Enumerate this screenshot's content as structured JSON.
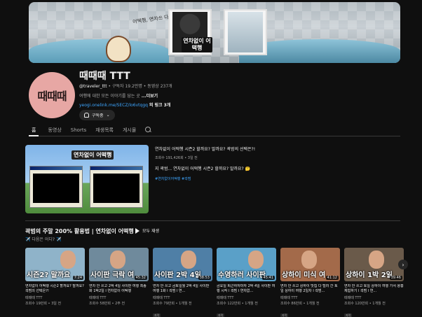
{
  "banner": {
    "title": "연차없이 어떡행",
    "mascot_text": "어떡행, 연차쓰 다 때때하네"
  },
  "channel": {
    "avatar_text": "때때때",
    "name": "때때때 TTT",
    "handle": "@traveler_ttt",
    "subscribers": "구독자 19.2만명",
    "videos": "동영상 237개",
    "description": "여행에 대한 모든 이야기를 담는 곳",
    "more_label": "...더보기",
    "link": "yeogi.onelink.me/SECZ/lo6vtqgq",
    "link_extra": "외 링크 3개",
    "subscribe_label": "구독중",
    "subscribe_chevron": "⌄"
  },
  "tabs": [
    {
      "label": "홈",
      "active": true
    },
    {
      "label": "동영상",
      "active": false
    },
    {
      "label": "Shorts",
      "active": false
    },
    {
      "label": "재생목록",
      "active": false
    },
    {
      "label": "게시물",
      "active": false
    }
  ],
  "featured": {
    "thumb_logo": "연차없이 어떡행",
    "title": "연차없이 어떡행 시즌2 할까요? 말까요? 곽범의 선택은?!",
    "meta": "조회수 191,426회 • 3일 전",
    "description": "지 곽범... 연차없이 어떡행 시즌2 할까요? 말까요? 🤔",
    "tags": "#연차없이어떡행 #곽범"
  },
  "section": {
    "title": "곽범의 주말 200% 활용법 | 연차없이 어떡행",
    "play_all": "모두 재생",
    "subtitle": "✈️ 다음은 어디? ✈️"
  },
  "cards": [
    {
      "caption": "시즌2? 말까요",
      "duration": "7:24",
      "title": "연차없이 어떡행 시즌2 할까요? 말까요? 곽범의 선택은?!",
      "channel": "때때때 TTT",
      "meta": "조회수 19만회 • 3일 전",
      "badge": "",
      "bg": "#8fb3c9"
    },
    {
      "caption": "사이판 극락 여",
      "duration": "45:32",
      "title": "연차 안 쓰고 2박 4일 사이판 여행 최종화 1박2일 l 연차없이 어떡행",
      "channel": "때때때 TTT",
      "meta": "조회수 58만회 • 2주 전",
      "badge": "",
      "bg": "#6f8a9c"
    },
    {
      "caption": "사이판 2박 4일",
      "duration": "38:53",
      "title": "연차 안 쓰고 금토일월 2박 4일 사이판 여행 1화 l 곽범 l 연...",
      "channel": "때때때 TTT",
      "meta": "조회수 79만회 • 1개월 전",
      "badge": "자막",
      "bg": "#4f7fa6"
    },
    {
      "caption": "수영하러 사이판",
      "duration": "45:41",
      "title": "금요일 퇴근하자마자 2박 4일 사이판 여행 시작 l 곽범 l 연차없...",
      "channel": "때때때 TTT",
      "meta": "조회수 122만회 • 1개월 전",
      "badge": "자막",
      "bg": "#5aa0c8"
    },
    {
      "caption": "상하이 미식 여",
      "duration": "41:12",
      "title": "연차 안 쓰고 상하이 맛집 다 털러 간 토일 상하이 여행 2일차 l 곽범...",
      "channel": "때때때 TTT",
      "meta": "조회수 86만회 • 1개월 전",
      "badge": "자막",
      "bg": "#a36a4a"
    },
    {
      "caption": "상하이 1박 2일",
      "duration": "39:46",
      "title": "연차 안 쓰고 토일 상하이 여행 가서 왕홍 체험하기 l 곽범 l 연...",
      "channel": "때때때 TTT",
      "meta": "조회수 120만회 • 1개월 전",
      "badge": "자막",
      "bg": "#6a5a4a"
    }
  ],
  "next_label": "›"
}
